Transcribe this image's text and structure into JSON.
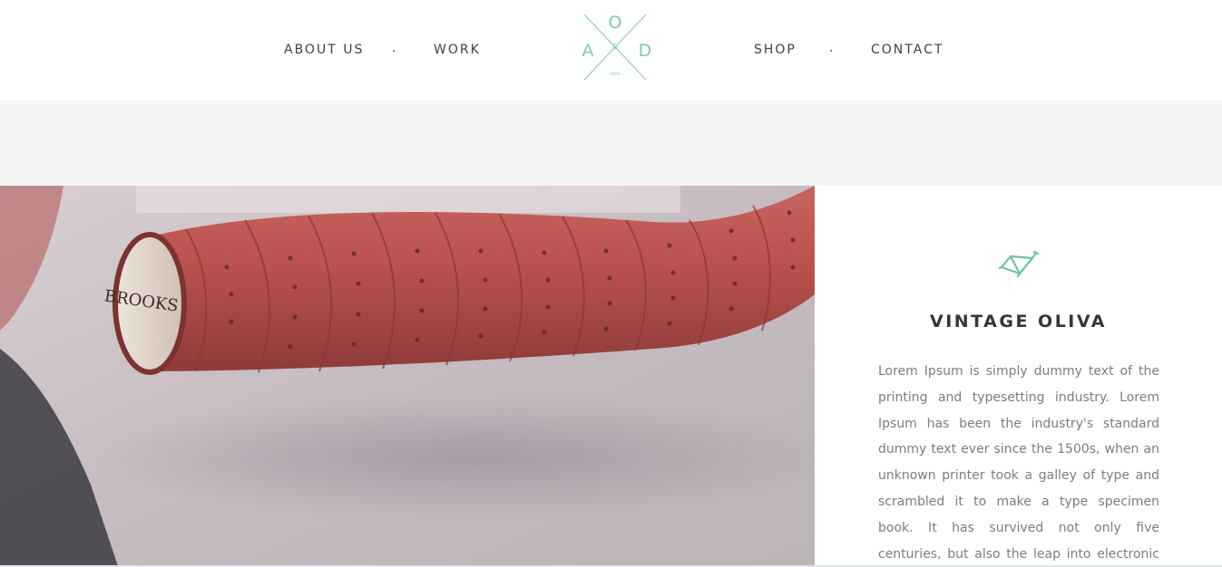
{
  "nav": {
    "about": "ABOUT US",
    "work": "WORK",
    "shop": "SHOP",
    "contact": "CONTACT",
    "separator": "."
  },
  "logo": {
    "letters": [
      "O",
      "A",
      "&",
      "D"
    ],
    "small_text": "100%",
    "color": "#7ccbb0"
  },
  "feature": {
    "image_label": "BROOKS",
    "icon": "bike-frame-icon",
    "title": "VINTAGE OLIVA",
    "text": "Lorem Ipsum is simply dummy text of the printing and typesetting industry. Lorem Ipsum has been the industry's standard dummy text ever since the 1500s, when an unknown printer took a galley of type and scrambled it to make a type specimen book. It has survived not only five centuries, but also the leap into electronic typesetting,"
  },
  "colors": {
    "accent": "#6cc4a4",
    "nav_text": "#3d4146",
    "body_text": "#7a7d81",
    "band": "#f5f5f5",
    "handlebar": "#b8504c"
  }
}
